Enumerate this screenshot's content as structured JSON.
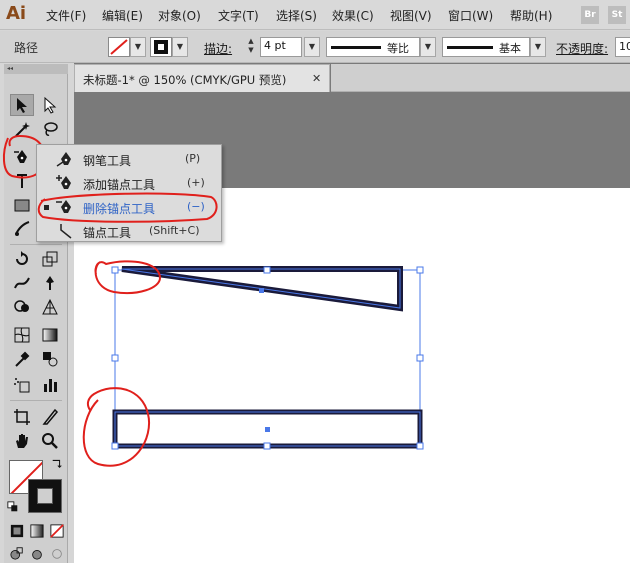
{
  "app": {
    "logo": "Ai",
    "badges": [
      "Br",
      "St"
    ]
  },
  "menu": [
    "文件(F)",
    "编辑(E)",
    "对象(O)",
    "文字(T)",
    "选择(S)",
    "效果(C)",
    "视图(V)",
    "窗口(W)",
    "帮助(H)"
  ],
  "control_bar": {
    "selection_label": "路径",
    "stroke_label": "描边:",
    "stroke_weight": "4 pt",
    "profile_label": "等比",
    "brush_label": "基本",
    "opacity_label": "不透明度:",
    "opacity_value": "10"
  },
  "document_tab": {
    "title": "未标题-1* @ 150% (CMYK/GPU 预览)",
    "close": "✕"
  },
  "flyout": {
    "items": [
      {
        "label": "钢笔工具",
        "shortcut": "(P)",
        "icon": "pen-icon"
      },
      {
        "label": "添加锚点工具",
        "shortcut": "(+)",
        "icon": "add-anchor-icon"
      },
      {
        "label": "删除锚点工具",
        "shortcut": "(−)",
        "icon": "delete-anchor-icon",
        "selected": true
      },
      {
        "label": "锚点工具",
        "shortcut": "(Shift+C)",
        "icon": "anchor-point-icon"
      }
    ]
  },
  "colors": {
    "highlight_text": "#2f63c6",
    "annotation_red": "#e0201c",
    "selection_blue": "#4a78e8",
    "path_fill": "#1a1a3a"
  }
}
